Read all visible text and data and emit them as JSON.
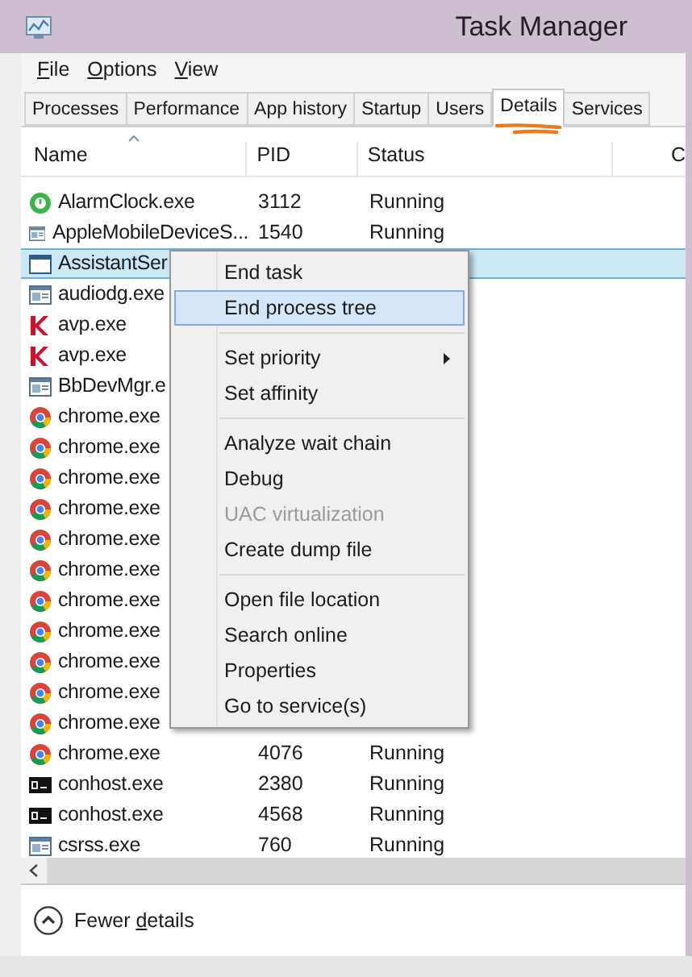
{
  "window": {
    "title": "Task Manager"
  },
  "menu_bar": [
    {
      "mnemonic": "F",
      "rest": "ile"
    },
    {
      "mnemonic": "O",
      "rest": "ptions"
    },
    {
      "mnemonic": "V",
      "rest": "iew"
    }
  ],
  "tabs": [
    {
      "label": "Processes",
      "selected": false
    },
    {
      "label": "Performance",
      "selected": false
    },
    {
      "label": "App history",
      "selected": false
    },
    {
      "label": "Startup",
      "selected": false
    },
    {
      "label": "Users",
      "selected": false
    },
    {
      "label": "Details",
      "selected": true
    },
    {
      "label": "Services",
      "selected": false
    }
  ],
  "annotations": [
    {
      "kind": "underline"
    }
  ],
  "columns": [
    {
      "label": "Name",
      "sorted": true
    },
    {
      "label": "PID",
      "sorted": false
    },
    {
      "label": "Status",
      "sorted": false
    },
    {
      "label": "C",
      "sorted": false
    }
  ],
  "rows": [
    {
      "kind": "alarm",
      "name": "AlarmClock.exe",
      "pid": "3112",
      "status": "Running",
      "selected": false
    },
    {
      "kind": "app",
      "name": "AppleMobileDeviceS...",
      "pid": "1540",
      "status": "Running",
      "selected": false
    },
    {
      "kind": "window",
      "name": "AssistantSer",
      "selected": true
    },
    {
      "kind": "app",
      "name": "audiodg.exe",
      "selected": false
    },
    {
      "kind": "antivirus",
      "name": "avp.exe",
      "selected": false
    },
    {
      "kind": "antivirus",
      "name": "avp.exe",
      "selected": false
    },
    {
      "kind": "app",
      "name": "BbDevMgr.e",
      "selected": false
    },
    {
      "kind": "browser",
      "name": "chrome.exe",
      "selected": false
    },
    {
      "kind": "browser",
      "name": "chrome.exe",
      "selected": false
    },
    {
      "kind": "browser",
      "name": "chrome.exe",
      "selected": false
    },
    {
      "kind": "browser",
      "name": "chrome.exe",
      "selected": false
    },
    {
      "kind": "browser",
      "name": "chrome.exe",
      "selected": false
    },
    {
      "kind": "browser",
      "name": "chrome.exe",
      "selected": false
    },
    {
      "kind": "browser",
      "name": "chrome.exe",
      "selected": false
    },
    {
      "kind": "browser",
      "name": "chrome.exe",
      "selected": false
    },
    {
      "kind": "browser",
      "name": "chrome.exe",
      "selected": false
    },
    {
      "kind": "browser",
      "name": "chrome.exe",
      "selected": false
    },
    {
      "kind": "browser",
      "name": "chrome.exe",
      "selected": false
    },
    {
      "kind": "browser",
      "name": "chrome.exe",
      "pid": "4076",
      "status": "Running",
      "selected": false
    },
    {
      "kind": "console",
      "name": "conhost.exe",
      "pid": "2380",
      "status": "Running",
      "selected": false
    },
    {
      "kind": "console",
      "name": "conhost.exe",
      "pid": "4568",
      "status": "Running",
      "selected": false
    },
    {
      "kind": "app",
      "name": "csrss.exe",
      "pid": "760",
      "status": "Running",
      "selected": false
    }
  ],
  "context_menu": [
    {
      "kind": "item",
      "label": "End task",
      "selected": false,
      "disabled": false,
      "submenu": false
    },
    {
      "kind": "item",
      "label": "End process tree",
      "selected": true,
      "disabled": false,
      "submenu": false
    },
    {
      "kind": "separator"
    },
    {
      "kind": "item",
      "label": "Set priority",
      "selected": false,
      "disabled": false,
      "submenu": true
    },
    {
      "kind": "item",
      "label": "Set affinity",
      "selected": false,
      "disabled": false,
      "submenu": false
    },
    {
      "kind": "separator"
    },
    {
      "kind": "item",
      "label": "Analyze wait chain",
      "selected": false,
      "disabled": false,
      "submenu": false
    },
    {
      "kind": "item",
      "label": "Debug",
      "selected": false,
      "disabled": false,
      "submenu": false
    },
    {
      "kind": "item",
      "label": "UAC virtualization",
      "selected": false,
      "disabled": true,
      "submenu": false
    },
    {
      "kind": "item",
      "label": "Create dump file",
      "selected": false,
      "disabled": false,
      "submenu": false
    },
    {
      "kind": "separator"
    },
    {
      "kind": "item",
      "label": "Open file location",
      "selected": false,
      "disabled": false,
      "submenu": false
    },
    {
      "kind": "item",
      "label": "Search online",
      "selected": false,
      "disabled": false,
      "submenu": false
    },
    {
      "kind": "item",
      "label": "Properties",
      "selected": false,
      "disabled": false,
      "submenu": false
    },
    {
      "kind": "item",
      "label": "Go to service(s)",
      "selected": false,
      "disabled": false,
      "submenu": false
    }
  ],
  "footer": {
    "before": "Fewer ",
    "mnemonic": "d",
    "after": "etails"
  }
}
